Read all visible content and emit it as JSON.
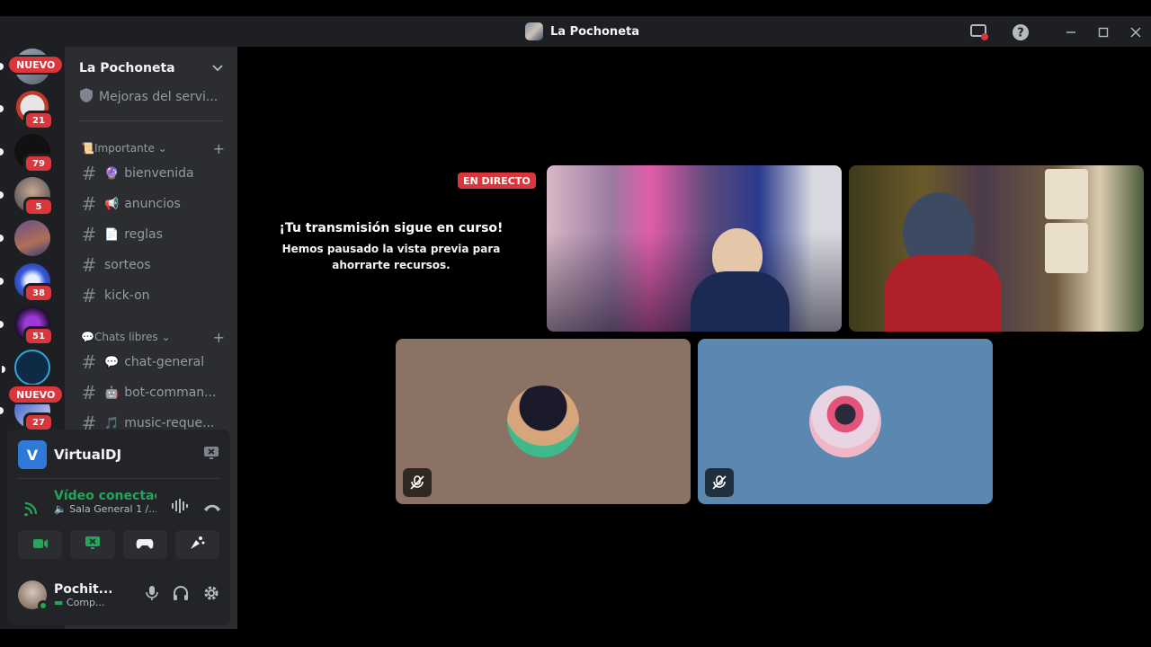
{
  "window": {
    "title": "La Pochoneta"
  },
  "colors": {
    "accent_red": "#da373c",
    "voice_green": "#23a55a",
    "tile_brown": "#8a7364",
    "tile_blue": "#5b88b0"
  },
  "guilds": {
    "badges": [
      "21",
      "79",
      "5",
      "38",
      "51",
      "27"
    ],
    "new_label": "NUEVO"
  },
  "sidebar": {
    "server_name": "La Pochoneta",
    "boost_item": "Mejoras del servi...",
    "categories": [
      {
        "name": "Importante",
        "emoji": "📜"
      },
      {
        "name": "Chats libres",
        "emoji": "💬"
      }
    ],
    "channels": [
      {
        "name": "bienvenida",
        "emoji": "🔮"
      },
      {
        "name": "anuncios",
        "emoji": "📢"
      },
      {
        "name": "reglas",
        "emoji": "📄"
      },
      {
        "name": "sorteos",
        "emoji": ""
      },
      {
        "name": "kick-on",
        "emoji": ""
      },
      {
        "name": "chat-general",
        "emoji": "💬"
      },
      {
        "name": "bot-comman...",
        "emoji": "🤖"
      },
      {
        "name": "music-reque...",
        "emoji": "🎵"
      }
    ]
  },
  "panel": {
    "app_name": "VirtualDJ",
    "app_initial": "V",
    "voice_status": "Vídeo conectac",
    "voice_channel": "Sala General 1 /...",
    "username": "Pochit...",
    "user_status": "Comp..."
  },
  "stage": {
    "live_label": "EN DIRECTO",
    "heading": "¡Tu transmisión sigue en curso!",
    "message": "Hemos pausado la vista previa para ahorrarte recursos."
  },
  "icons": [
    "screen-share-icon",
    "help-icon",
    "minimize-icon",
    "maximize-icon",
    "close-icon",
    "chevron-down-icon",
    "shield-icon",
    "plus-icon",
    "camera-icon",
    "screen-icon",
    "gamepad-icon",
    "soundboard-icon",
    "mic-icon",
    "headphones-icon",
    "gear-icon",
    "waveform-icon",
    "hangup-icon",
    "muted-mic-icon"
  ]
}
